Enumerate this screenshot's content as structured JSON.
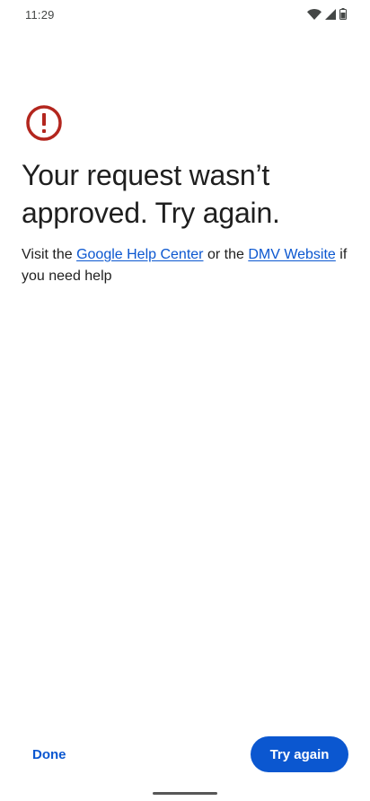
{
  "status_bar": {
    "time": "11:29",
    "icons": [
      "wifi-icon",
      "cellular-signal-icon",
      "battery-icon"
    ]
  },
  "error_icon": "error-exclamation-icon",
  "title": "Your request wasn’t approved. Try again.",
  "help": {
    "prefix": "Visit the ",
    "link1": "Google Help Center",
    "middle": " or the ",
    "link2": "DMV Website",
    "suffix": " if you need help"
  },
  "actions": {
    "done_label": "Done",
    "try_again_label": "Try again"
  },
  "colors": {
    "accent": "#0b57d0",
    "error": "#b3261e",
    "text": "#1f1f1f"
  }
}
